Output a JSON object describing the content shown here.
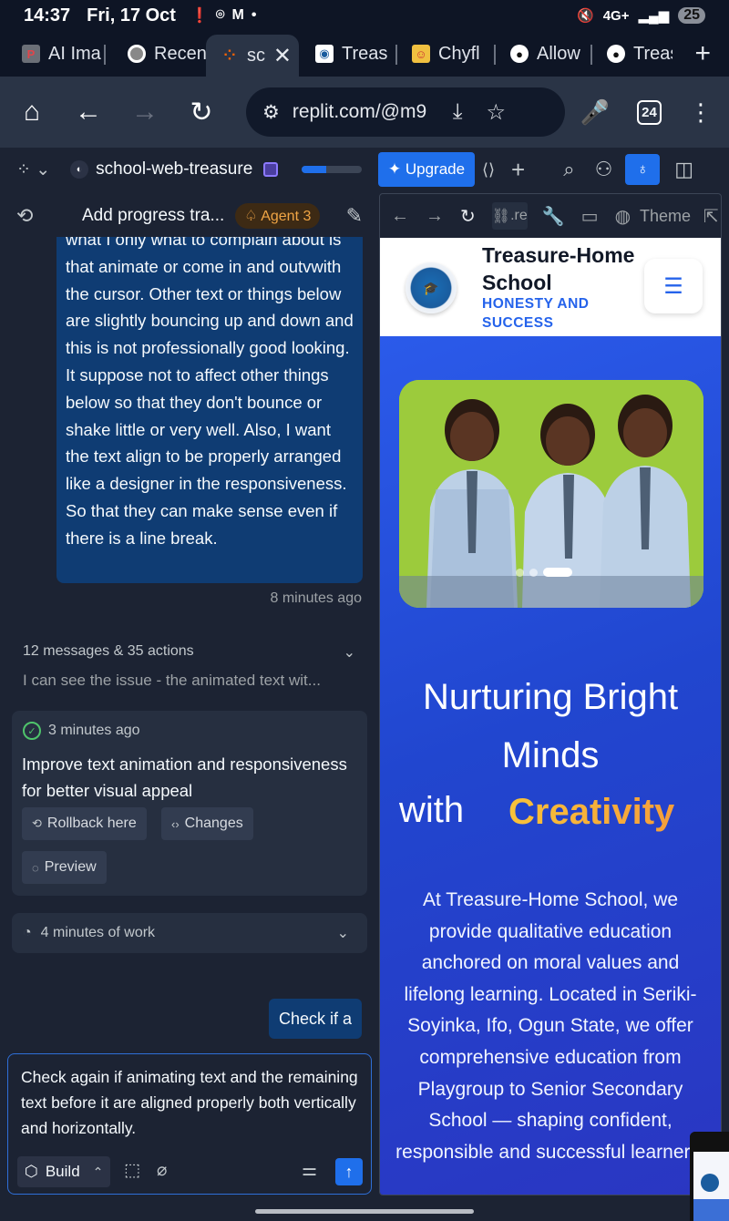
{
  "status_bar": {
    "time": "14:37",
    "date": "Fri, 17 Oct",
    "battery": "25",
    "network": "4G+"
  },
  "browser": {
    "tabs": [
      {
        "label": "AI Ima",
        "icon": "P",
        "color": "#e0454b"
      },
      {
        "label": "Recen",
        "icon": "chrome-icon",
        "color": "#ffffff"
      },
      {
        "label": "scl",
        "icon": "replit-icon",
        "color": "#f26207"
      },
      {
        "label": "Treas",
        "icon": "school-icon",
        "color": "#3b82f6"
      },
      {
        "label": "Chyfl",
        "icon": "app-icon",
        "color": "#e55"
      },
      {
        "label": "Allow",
        "icon": "github-icon",
        "color": "#ffffff"
      },
      {
        "label": "Treas",
        "icon": "github-icon",
        "color": "#ffffff"
      }
    ],
    "url": "replit.com/@m9",
    "tab_count": "24"
  },
  "replit": {
    "project_name": "school-web-treasure",
    "progress": 0.4,
    "upgrade_label": "Upgrade",
    "chat_title": "Add progress tra...",
    "agent_badge": "Agent 3",
    "user_message": "what I only what to complain about is that animate or come in and outvwith the cursor. Other text or things below are slightly bouncing up and down and this is not professionally good looking. It suppose not to affect other things below so that they don't bounce or shake little or very well. Also, I want the text align to be properly arranged like a designer in the responsiveness. So that they can make sense even if there is a line break.",
    "message_time": "8 minutes ago",
    "actions_summary": "12 messages & 35 actions",
    "actions_preview": "I can see the issue - the animated text wit...",
    "checkpoint": {
      "time": "3 minutes ago",
      "title": "Improve text animation and responsiveness for better visual appeal",
      "rollback_label": "Rollback here",
      "changes_label": "Changes",
      "preview_label": "Preview"
    },
    "work_label": "4 minutes of work",
    "pending_message": "Check if a",
    "composer_text": "Check again if animating text and the remaining text before it are aligned properly both vertically and horizontally.",
    "build_label": "Build"
  },
  "webview": {
    "url_short": ".re",
    "theme_label": "Theme"
  },
  "site": {
    "title": "Treasure-Home School",
    "motto": "HONESTY AND SUCCESS",
    "headline": "Nurturing Bright Minds",
    "headline_with": "with",
    "headline_accent": "Creativity",
    "body": "At Treasure-Home School, we provide qualitative education anchored on moral values and lifelong learning. Located in Seriki-Soyinka, Ifo, Ogun State, we offer comprehensive education from Playgroup to Senior Secondary School — shaping confident, responsible and successful learners.",
    "carousel_active": 3,
    "carousel_total": 3
  }
}
